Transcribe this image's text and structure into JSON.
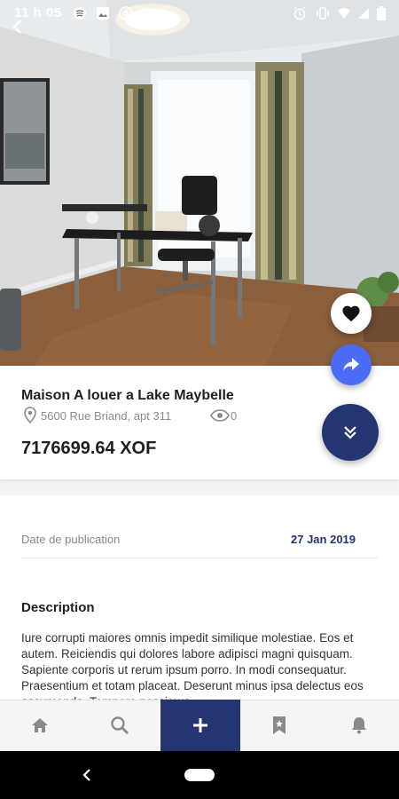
{
  "status_bar": {
    "time": "11 h 05"
  },
  "listing": {
    "title": "Maison A louer a Lake Maybelle",
    "address": "5600 Rue Briand, apt 311",
    "views": "0",
    "price": "7176699.64 XOF"
  },
  "details": {
    "publication_label": "Date de publication",
    "publication_date": "27 Jan 2019"
  },
  "description": {
    "title": "Description",
    "text": "Iure corrupti maiores omnis impedit similique molestiae. Eos et autem. Reiciendis qui dolores labore adipisci magni quisquam. Sapiente corporis ut rerum ipsum porro. In modi consequatur. Praesentium et totam placeat. Deserunt minus ipsa delectus eos assumenda. Tempore possimus"
  },
  "bottom_nav": {
    "items": [
      "home-icon",
      "search-icon",
      "add-icon",
      "bookmark-icon",
      "notification-bell-icon"
    ],
    "active_index": 2
  },
  "colors": {
    "primary": "#243672",
    "share_button": "#4a6cf7",
    "favorite_button": "#ffffff"
  }
}
